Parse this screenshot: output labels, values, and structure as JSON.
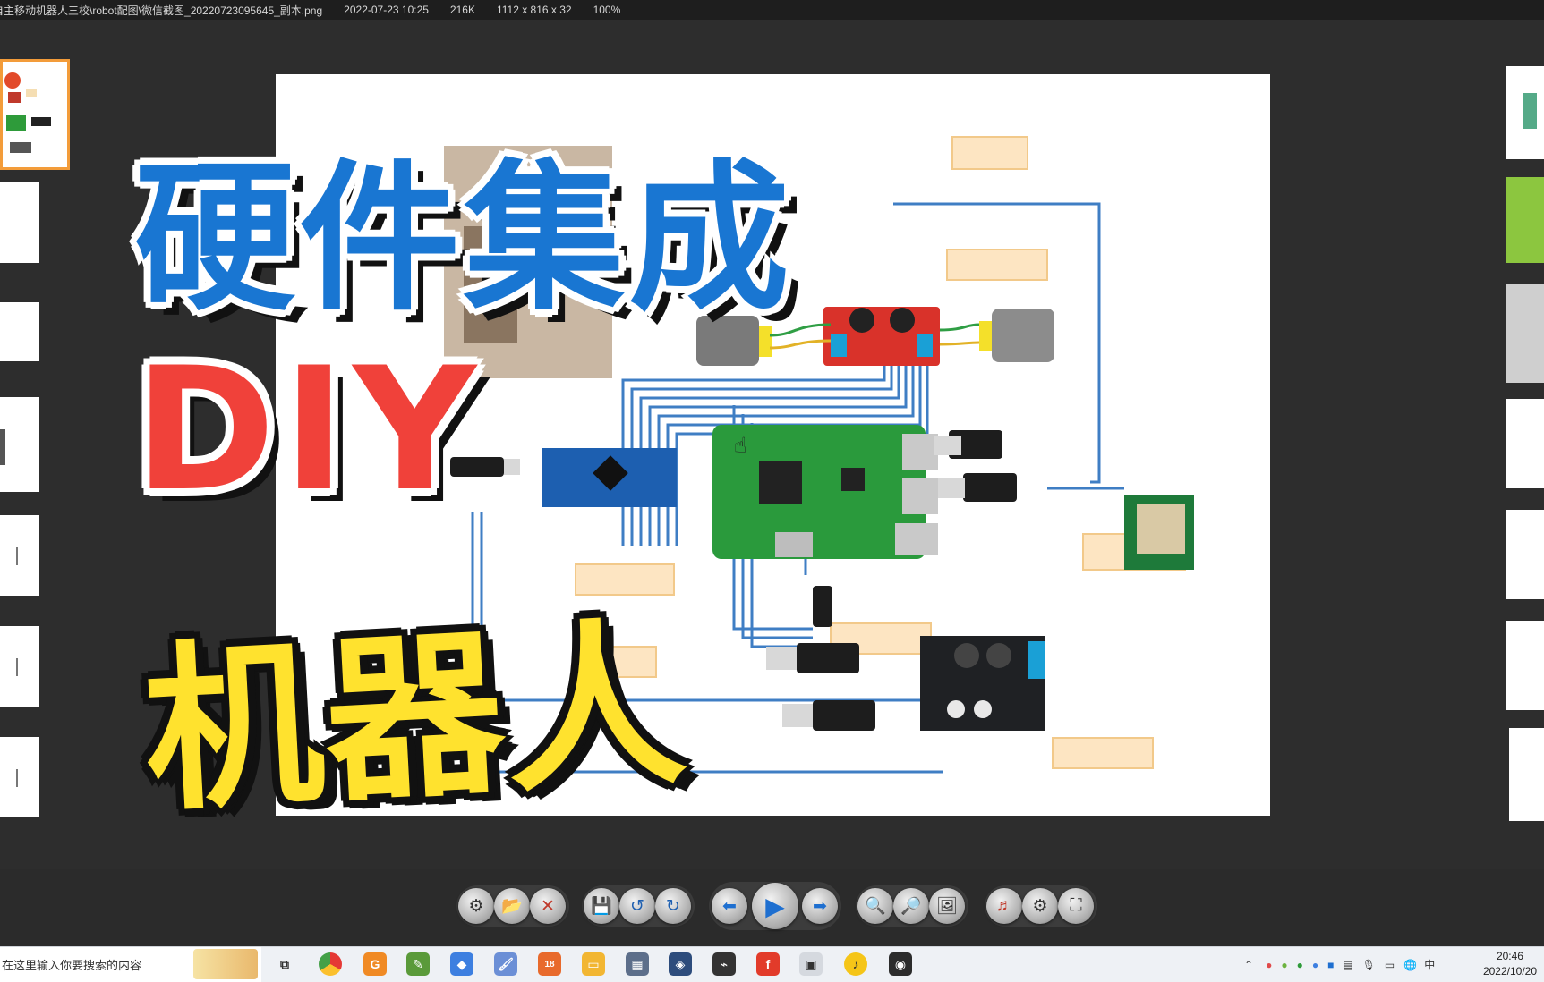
{
  "info_bar": {
    "path": "自主移动机器人三校\\robot配图\\微信截图_20220723095645_副本.png",
    "datetime": "2022-07-23 10:25",
    "filesize": "216K",
    "dimensions": "1112 x 816 x 32",
    "zoom": "100%"
  },
  "overlay": {
    "line1": "硬件集成",
    "line2": "DIY",
    "line3": "机器人"
  },
  "toolbar_buttons": [
    {
      "icon": "settings-icon"
    },
    {
      "icon": "open-folder-icon"
    },
    {
      "icon": "delete-icon"
    },
    {
      "icon": "save-icon"
    },
    {
      "icon": "rotate-left-icon"
    },
    {
      "icon": "rotate-right-icon"
    },
    {
      "icon": "previous-icon"
    },
    {
      "icon": "play-icon"
    },
    {
      "icon": "next-icon"
    },
    {
      "icon": "zoom-out-icon"
    },
    {
      "icon": "zoom-in-icon"
    },
    {
      "icon": "fit-window-icon"
    },
    {
      "icon": "music-icon"
    },
    {
      "icon": "options-icon"
    },
    {
      "icon": "fullscreen-icon"
    }
  ],
  "taskbar": {
    "search_placeholder": "在这里输入你要搜索的内容",
    "ime": "中",
    "time": "20:46",
    "date": "2022/10/20"
  },
  "colors": {
    "accent_blue": "#1976d2",
    "accent_red": "#f0413a",
    "accent_yellow": "#ffe22e"
  }
}
